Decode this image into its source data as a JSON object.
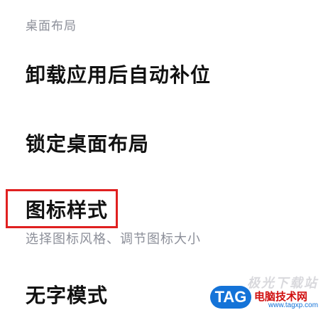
{
  "section": {
    "header": "桌面布局"
  },
  "items": [
    {
      "title": "卸载应用后自动补位"
    },
    {
      "title": "锁定桌面布局"
    },
    {
      "title": "图标样式",
      "subtitle": "选择图标风格、调节图标大小"
    },
    {
      "title": "无字模式"
    }
  ],
  "highlight": {
    "color": "#e02020",
    "target": "图标样式"
  },
  "watermark": {
    "top_text": "极光下载站",
    "badge": "TAG",
    "site": "电脑技术网",
    "url": "www.tagxp.com"
  }
}
